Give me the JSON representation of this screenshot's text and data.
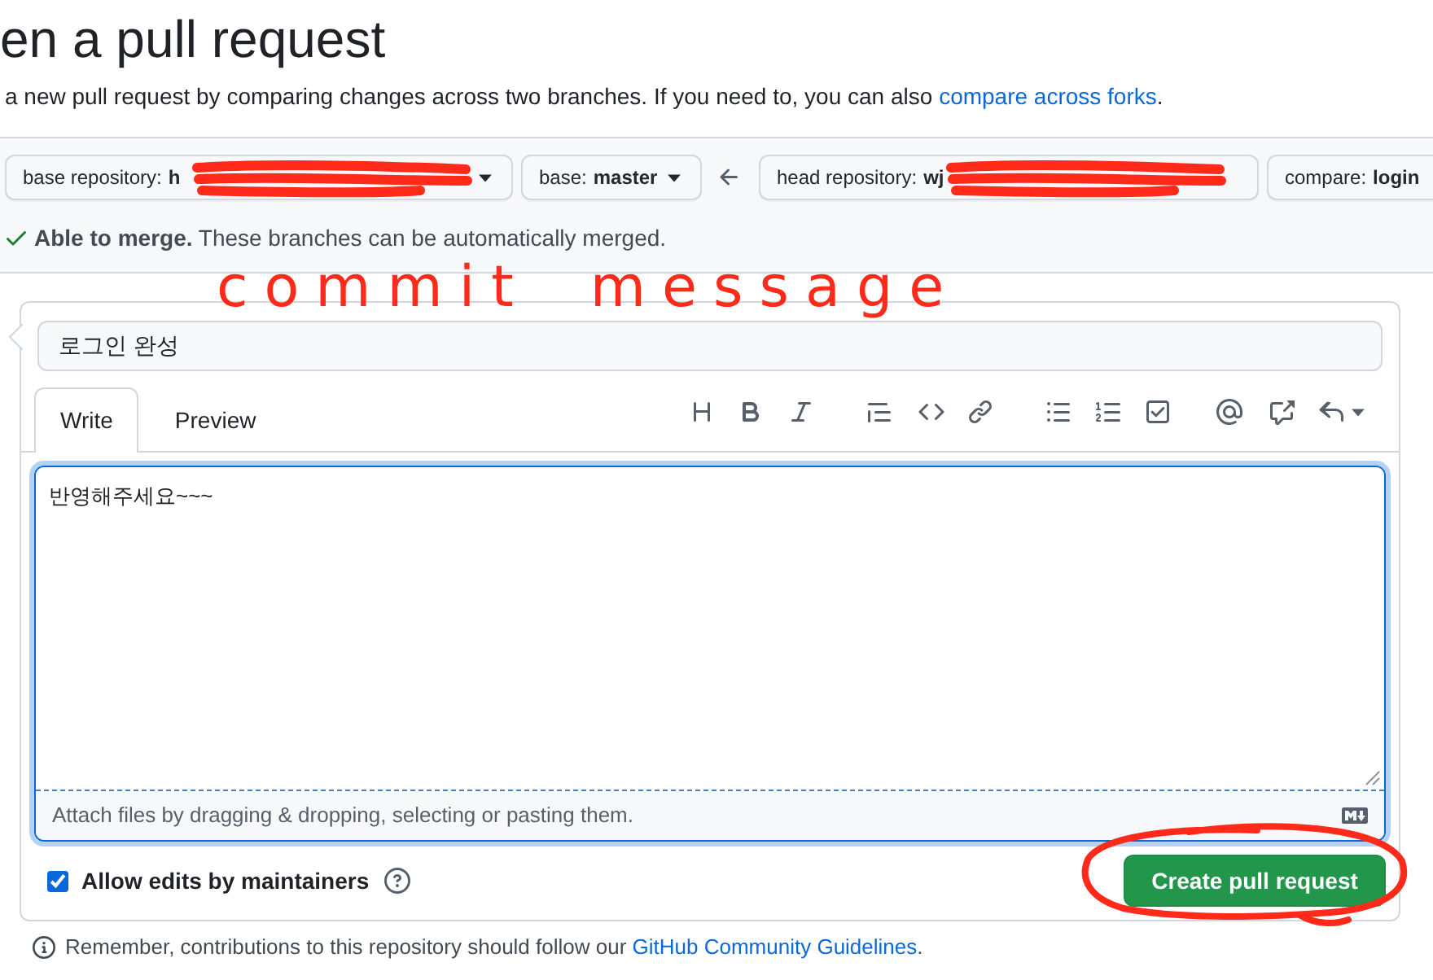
{
  "page": {
    "title": "en a pull request",
    "description": "a new pull request by comparing changes across two branches. If you need to, you can also ",
    "description_link": "compare across forks",
    "description_end": "."
  },
  "compare_bar": {
    "base": [
      {
        "label": "base repository:",
        "value": "h",
        "redacted": true,
        "caret": true
      },
      {
        "label": "base:",
        "value": "master",
        "redacted": false,
        "caret": true
      }
    ],
    "head": [
      {
        "label": "head repository:",
        "value": "wj",
        "redacted": true,
        "caret": false
      },
      {
        "label": "compare:",
        "value": "login",
        "redacted": false,
        "caret": false
      }
    ]
  },
  "merge_status": {
    "mergeable": true,
    "text": "**Able to merge.** These branches can be automatically merged."
  },
  "form": {
    "title_field": {
      "value": "로그인 완성"
    },
    "tabs": [
      {
        "label": "Write",
        "selected": true
      },
      {
        "label": "Preview",
        "selected": false
      }
    ],
    "body_field": {
      "value": "반영해주세요~~~"
    },
    "attach_hint": "Attach files by dragging & dropping, selecting or pasting them.",
    "allow_edits": {
      "label": "Allow edits by maintainers",
      "checked": true
    },
    "submit_button": "Create pull request"
  },
  "footer": {
    "text": "Remember, contributions to this repository should follow our ",
    "link": "GitHub Community Guidelines",
    "end": "."
  },
  "annotations": [
    {
      "kind": "handwriting",
      "text": "commit message"
    },
    {
      "kind": "circle"
    }
  ]
}
